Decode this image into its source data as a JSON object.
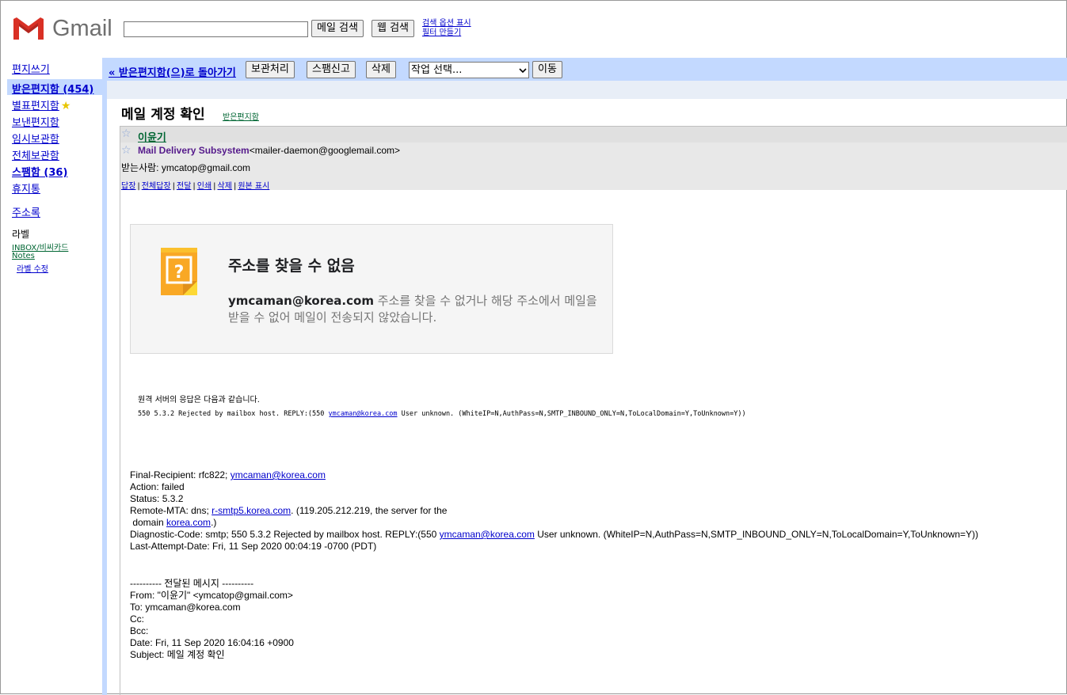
{
  "header": {
    "logo_text": "Gmail",
    "search_value": "",
    "search_mail_label": "메일 검색",
    "search_web_label": "웹 검색",
    "search_options_link": "검색 옵션 표시",
    "create_filter_link": "필터 만들기"
  },
  "colors": {
    "gmail_red": "#d93025",
    "toolbar_blue": "#c3d9ff",
    "label_green": "#006633",
    "link_blue": "#0000cc"
  },
  "sidebar": {
    "compose": "편지쓰기",
    "inbox": "받은편지함 (454)",
    "starred": "별표편지함",
    "sent": "보낸편지함",
    "drafts": "임시보관함",
    "all_mail": "전체보관함",
    "spam": "스팸함 (36)",
    "trash": "휴지통",
    "contacts": "주소록",
    "labels_title": "라벨",
    "labels": [
      "INBOX/비씨카드",
      "Notes"
    ],
    "edit_labels": "라벨 수정"
  },
  "toolbar": {
    "back": "« 받은편지함(으)로 돌아가기",
    "archive": "보관처리",
    "report_spam": "스팸신고",
    "delete": "삭제",
    "action_select": "작업 선택...",
    "move": "이동"
  },
  "message": {
    "subject": "메일 계정 확인",
    "label": "받은편지함",
    "thread_sender": "이윤기",
    "from_name": "Mail Delivery Subsystem",
    "from_addr": "<mailer-daemon@googlemail.com>",
    "to": "받는사람: ymcatop@gmail.com",
    "actions": [
      "답장",
      "전체답장",
      "전달",
      "인쇄",
      "삭제",
      "원본 표시"
    ]
  },
  "bounce": {
    "icon": "warning-note-icon",
    "title": "주소를 찾을 수 없음",
    "address": "ymcaman@korea.com",
    "text": " 주소를 찾을 수 없거나 해당 주소에서 메일을 받을 수 없어 메일이 전송되지 않았습니다.",
    "server_intro": "원격 서버의 응답은 다음과 같습니다.",
    "server_reply_prefix": "550 5.3.2 Rejected by mailbox host. REPLY:(550 ",
    "server_reply_addr": "ymcaman@korea.com",
    "server_reply_suffix": " User unknown. (WhiteIP=N,AuthPass=N,SMTP_INBOUND_ONLY=N,ToLocalDomain=Y,ToUnknown=Y))"
  },
  "dsn": {
    "final_recipient_prefix": "Final-Recipient: rfc822; ",
    "final_recipient_addr": "ymcaman@korea.com",
    "action": "Action: failed",
    "status": "Status: 5.3.2",
    "remote_mta_prefix": "Remote-MTA: dns; ",
    "remote_mta_host": "r-smtp5.korea.com",
    "remote_mta_suffix": ". (119.205.212.219, the server for the",
    "domain_prefix": " domain ",
    "domain_link": "korea.com",
    "domain_suffix": ".)",
    "diagnostic_prefix": "Diagnostic-Code: smtp; 550 5.3.2 Rejected by mailbox host. REPLY:(550 ",
    "diagnostic_addr": "ymcaman@korea.com",
    "diagnostic_suffix": " User unknown. (WhiteIP=N,AuthPass=N,SMTP_INBOUND_ONLY=N,ToLocalDomain=Y,ToUnknown=Y))",
    "last_attempt": "Last-Attempt-Date: Fri, 11 Sep 2020 00:04:19 -0700 (PDT)"
  },
  "forwarded": {
    "divider": "---------- 전달된 메시지 ----------",
    "from": "From: \"이윤기\" <ymcatop@gmail.com>",
    "to": "To: ymcaman@korea.com",
    "cc": "Cc:",
    "bcc": "Bcc:",
    "date": "Date: Fri, 11 Sep 2020 16:04:16 +0900",
    "subject": "Subject: 메일 계정 확인"
  }
}
